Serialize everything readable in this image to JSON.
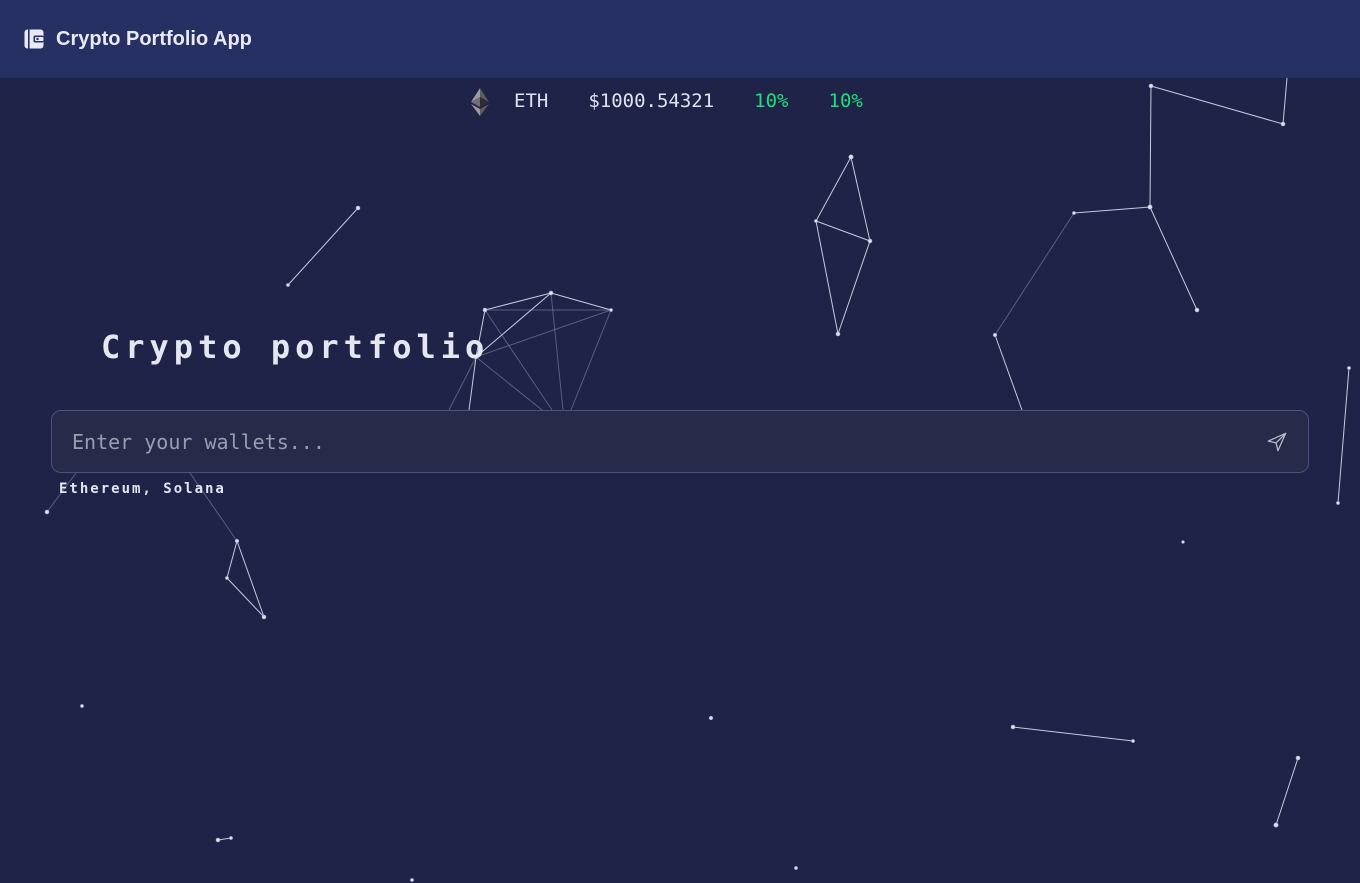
{
  "header": {
    "app_title": "Crypto Portfolio App",
    "app_icon": "wallet-icon"
  },
  "ticker": {
    "coin_icon": "ethereum-icon",
    "symbol": "ETH",
    "price": "$1000.54321",
    "change_1": "10%",
    "change_2": "10%",
    "positive_color": "#1ee07a"
  },
  "hero": {
    "title": "Crypto portfolio"
  },
  "search": {
    "placeholder": "Enter your wallets...",
    "value": "",
    "send_icon": "send-icon"
  },
  "hint": {
    "text": "Ethereum, Solana"
  },
  "colors": {
    "background": "#1e2347",
    "header": "#263062",
    "input_bg": "#272b49"
  }
}
